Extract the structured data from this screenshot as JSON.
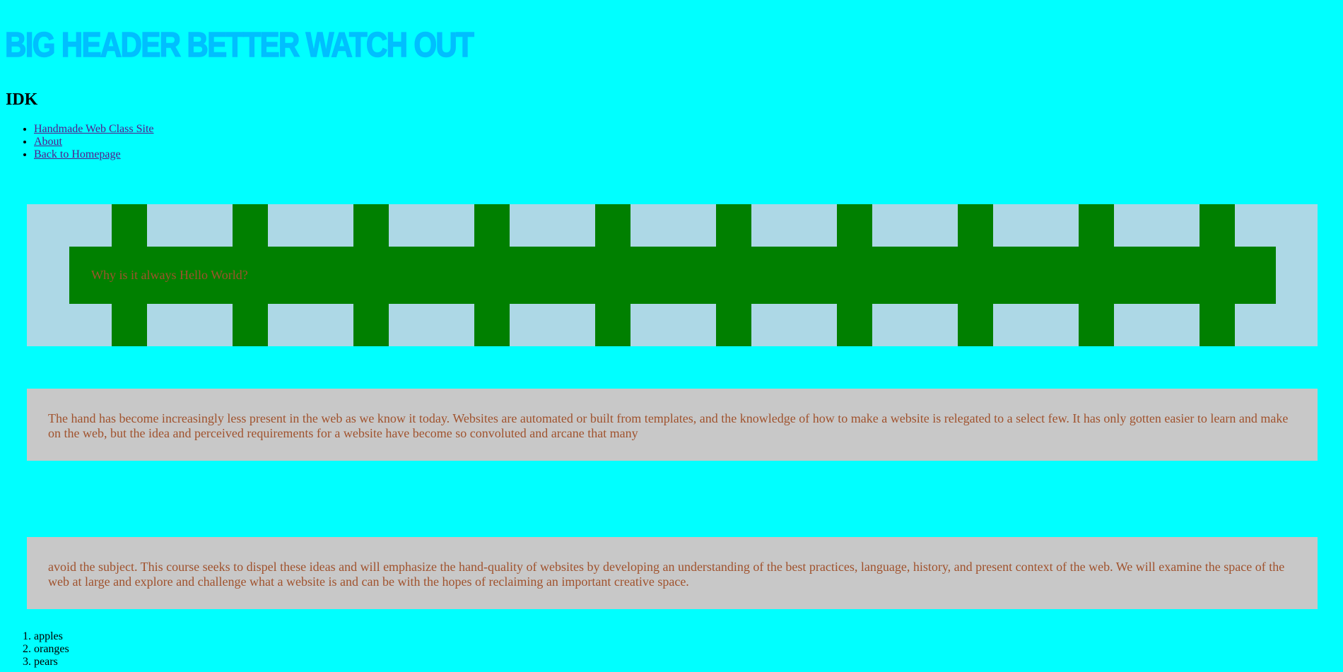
{
  "header": {
    "big_title": "BIG HEADER BETTER WATCH OUT",
    "subtitle": "IDK"
  },
  "nav": {
    "items": [
      {
        "label": "Handmade Web Class Site"
      },
      {
        "label": "About"
      },
      {
        "label": "Back to Homepage"
      }
    ]
  },
  "hello": {
    "text": "Why is it always Hello World?"
  },
  "paragraphs": [
    {
      "text": "The hand has become increasingly less present in the web as we know it today. Websites are automated or built from templates, and the knowledge of how to make a website is relegated to a select few. It has only gotten easier to learn and make on the web, but the idea and perceived requirements for a website have become so convoluted and arcane that many"
    },
    {
      "text": "avoid the subject. This course seeks to dispel these ideas and will emphasize the hand-quality of websites by developing an understanding of the best practices, language, history, and present context of the web. We will examine the space of the web at large and explore and challenge what a website is and can be with the hopes of reclaiming an important creative space."
    }
  ],
  "fruits": {
    "items": [
      {
        "label": "apples"
      },
      {
        "label": "oranges"
      },
      {
        "label": "pears"
      }
    ]
  },
  "colors": {
    "page_background": "#00ffff",
    "big_header": "#00bfff",
    "link": "#551a8b",
    "hello_box_background": "#add8e6",
    "hello_stripes": "#008000",
    "paragraph_text": "#a0522d",
    "paragraph_box": "#c8c8c8"
  }
}
